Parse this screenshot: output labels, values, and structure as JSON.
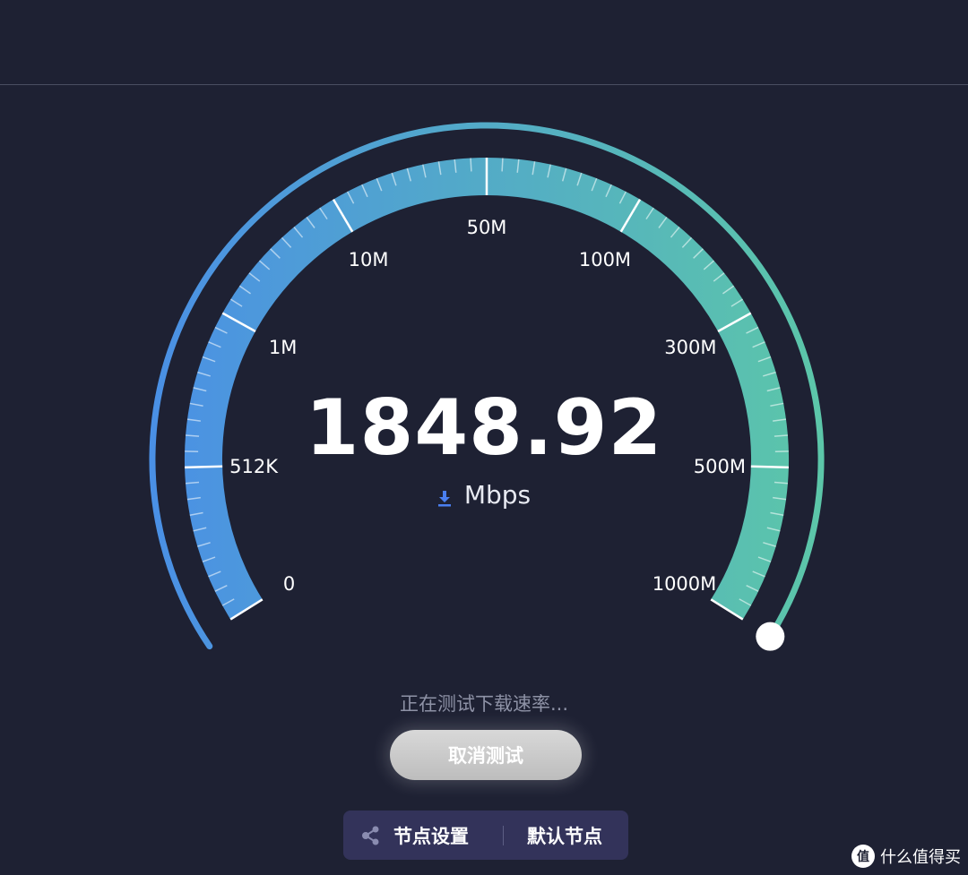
{
  "gauge": {
    "value": "1848.92",
    "unit": "Mbps",
    "scale_labels": [
      "0",
      "512K",
      "1M",
      "10M",
      "50M",
      "100M",
      "300M",
      "500M",
      "1000M"
    ],
    "gradient_start": "#4a8fe6",
    "gradient_end": "#5cc7a8",
    "progress_fraction": 1.0
  },
  "status": "正在测试下载速率...",
  "cancel_label": "取消测试",
  "node_bar": {
    "settings_label": "节点设置",
    "default_label": "默认节点",
    "settings_icon": "nodes-icon"
  },
  "watermark": {
    "logo": "值",
    "text": "什么值得买"
  },
  "colors": {
    "background": "#1e2133",
    "node_bar": "#33335a",
    "download_icon": "#4a7ff0"
  }
}
